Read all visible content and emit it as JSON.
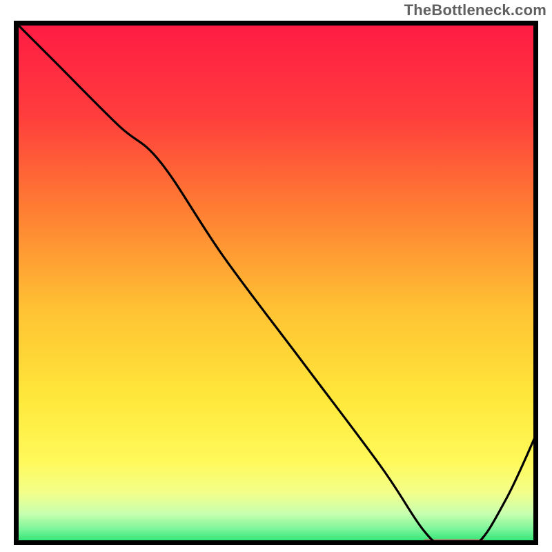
{
  "watermark": "TheBottleneck.com",
  "chart_data": {
    "type": "line",
    "title": "",
    "xlabel": "",
    "ylabel": "",
    "xlim": [
      0,
      100
    ],
    "ylim": [
      0,
      100
    ],
    "grid": false,
    "legend": false,
    "background": {
      "type": "vertical-gradient",
      "stops": [
        {
          "pos": 0.0,
          "color": "#ff1a44"
        },
        {
          "pos": 0.18,
          "color": "#ff3d3d"
        },
        {
          "pos": 0.35,
          "color": "#ff7a33"
        },
        {
          "pos": 0.55,
          "color": "#ffc233"
        },
        {
          "pos": 0.72,
          "color": "#ffe83a"
        },
        {
          "pos": 0.84,
          "color": "#fff95a"
        },
        {
          "pos": 0.9,
          "color": "#f3ff8a"
        },
        {
          "pos": 0.94,
          "color": "#c8ffb0"
        },
        {
          "pos": 0.97,
          "color": "#7af59a"
        },
        {
          "pos": 1.0,
          "color": "#18e06a"
        }
      ]
    },
    "series": [
      {
        "name": "bottleneck-curve",
        "note": "black curve; y is distance from optimum (higher = worse)",
        "x": [
          0,
          8,
          20,
          28,
          40,
          55,
          70,
          78,
          82,
          88,
          94,
          100
        ],
        "y": [
          100,
          92,
          80,
          73,
          55,
          35,
          15,
          3,
          0,
          0,
          9,
          22
        ]
      }
    ],
    "optimum_marker": {
      "name": "optimum-bar",
      "color": "#cc6666",
      "x_start": 78,
      "x_end": 90,
      "y": 0.5,
      "thickness_pct": 1.2
    }
  }
}
